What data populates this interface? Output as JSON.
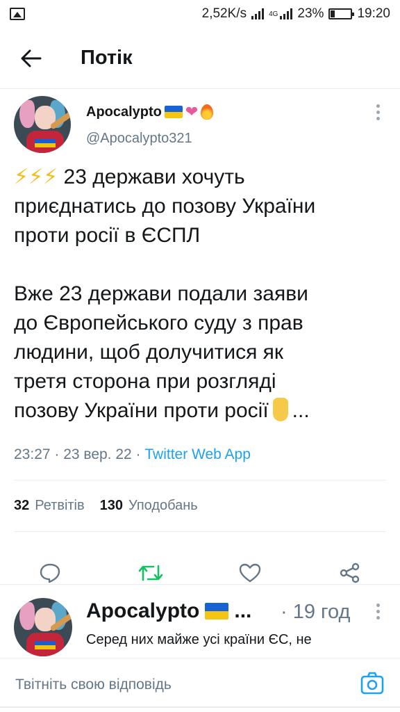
{
  "status_bar": {
    "speed": "2,52K/s",
    "network": "4G",
    "battery": "23%",
    "battery_level": 0.23,
    "time": "19:20"
  },
  "header": {
    "title": "Потік",
    "back_icon": "arrow-left-icon"
  },
  "tweet": {
    "author_name": "Apocalypto",
    "handle": "@Apocalypto321",
    "lines_para1": [
      "23 держави хочуть",
      "приєднатись до позову України",
      "проти росії в ЄСПЛ"
    ],
    "bolts": "⚡⚡⚡",
    "lines_para2": [
      "Вже 23 держави подали заяви",
      "до Європейського суду з прав",
      "людини, щоб долучитися як",
      "третя сторона при розгляді",
      "позову України проти росії"
    ],
    "ellipsis": "...",
    "time": "23:27 · 23 вер. 22 · ",
    "source": "Twitter Web App",
    "retweets_count": "32",
    "retweets_label": "Ретвітів",
    "likes_count": "130",
    "likes_label": "Уподобань",
    "colors": {
      "accent": "#1da1f2",
      "retweet": "#17bf63",
      "muted": "#657786"
    }
  },
  "reply": {
    "author_name": "Apocalypto",
    "truncation": "...",
    "time": "· 19 год",
    "text": "Серед них майже усі країни ЄС, не"
  },
  "reply_bar": {
    "placeholder": "Твітніть свою відповідь",
    "camera_icon": "camera-icon"
  }
}
